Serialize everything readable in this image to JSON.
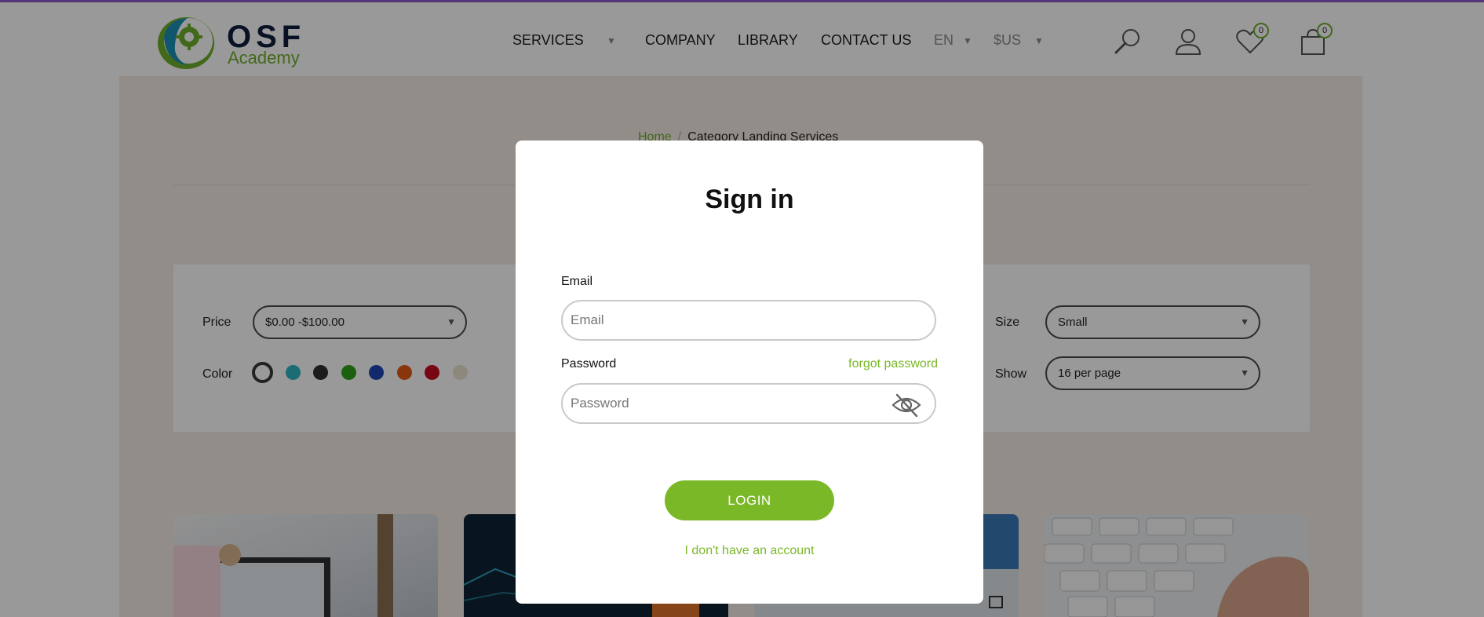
{
  "header": {
    "logo": {
      "brand": "OSF",
      "sub": "Academy"
    },
    "nav": {
      "services": "SERVICES",
      "company": "COMPANY",
      "library": "LIBRARY",
      "contact": "CONTACT US",
      "language": "EN",
      "currency": "$US"
    },
    "wishlist_count": "0",
    "cart_count": "0"
  },
  "breadcrumb": {
    "home": "Home",
    "separator": "/",
    "current": "Category Landing Services"
  },
  "filters": {
    "price_label": "Price",
    "price_value": "$0.00 -$100.00",
    "color_label": "Color",
    "colors": [
      "#ffffff",
      "#2fb4c4",
      "#2f2f2f",
      "#2da11a",
      "#1f47b5",
      "#e45d11",
      "#c8091e",
      "#e9e3cf"
    ],
    "size_label": "Size",
    "size_value": "Small",
    "show_label": "Show",
    "show_value": "16 per page"
  },
  "modal": {
    "title": "Sign in",
    "email_label": "Email",
    "email_placeholder": "Email",
    "password_label": "Password",
    "password_placeholder": "Password",
    "forgot_password": "forgot password",
    "login_button": "LOGIN",
    "no_account": "I don't have an account"
  },
  "colors": {
    "accent": "#7ab827",
    "top_bar": "#8a5cc7",
    "logo_navy": "#0f1f3c"
  }
}
